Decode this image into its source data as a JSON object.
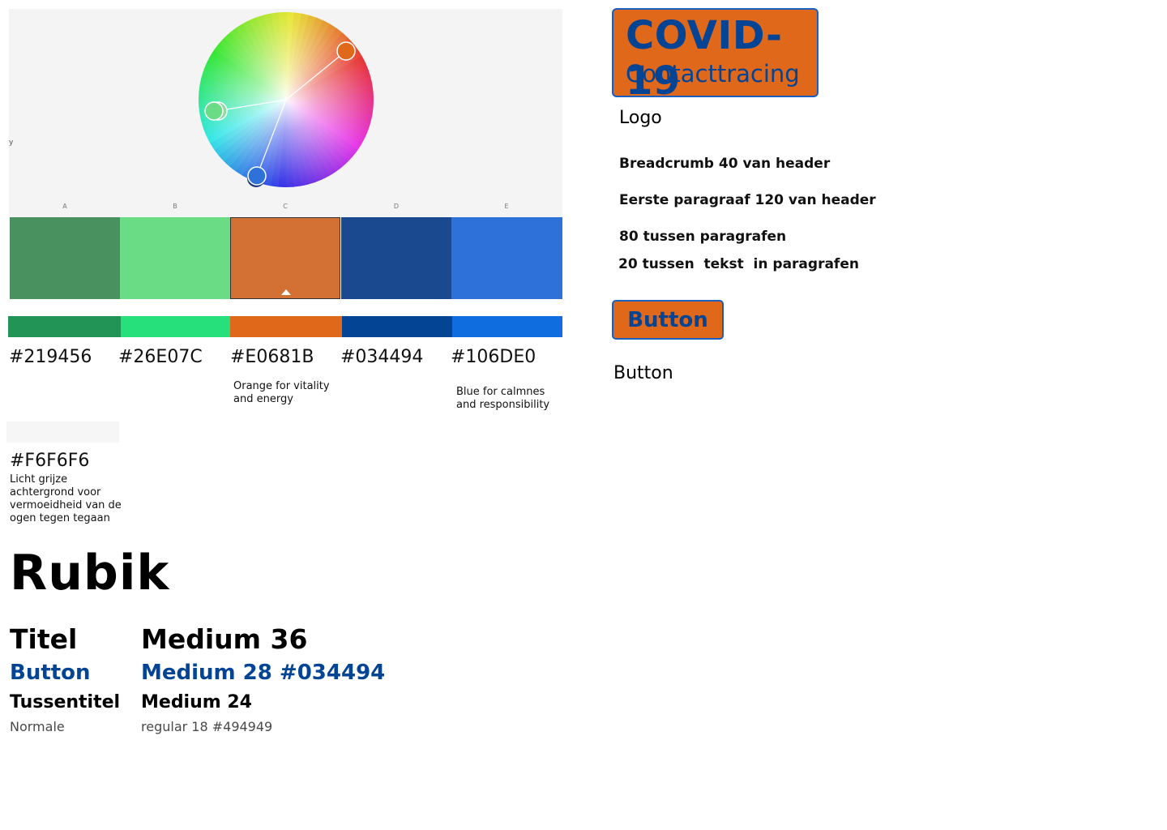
{
  "palette": {
    "side_label": "y",
    "letters": [
      "A",
      "B",
      "C",
      "D",
      "E"
    ],
    "big_swatches": [
      "#4A9160",
      "#6ADC86",
      "#D27133",
      "#1A4990",
      "#2D71D9"
    ],
    "colors": [
      {
        "hex": "#219456"
      },
      {
        "hex": "#26E07C"
      },
      {
        "hex": "#E0681B",
        "note": [
          "Orange for vitality",
          "and energy"
        ]
      },
      {
        "hex": "#034494"
      },
      {
        "hex": "#106DE0",
        "note": [
          "Blue for calmnes",
          "and responsibility"
        ]
      }
    ],
    "background": {
      "hex": "#F6F6F6",
      "note": [
        "Licht grijze",
        "achtergrond voor",
        "vermoeidheid van de",
        "ogen tegen tegaan"
      ]
    }
  },
  "typography": {
    "font_name": "Rubik",
    "rows": [
      {
        "name": "Titel",
        "spec": "Medium 36"
      },
      {
        "name": "Button",
        "spec": "Medium 28 #034494"
      },
      {
        "name": "Tussentitel",
        "spec": "Medium 24"
      },
      {
        "name": "Normale",
        "spec": "regular 18 #494949"
      }
    ]
  },
  "logo": {
    "title": "COVID-19",
    "subtitle": "Contacttracing",
    "caption": "Logo"
  },
  "spacing": {
    "breadcrumb": "Breadcrumb 40 van header",
    "first_paragraph": "Eerste paragraaf 120 van header",
    "between_paragraphs": "80 tussen paragrafen",
    "within_paragraphs": "20 tussen  tekst  in paragrafen"
  },
  "button": {
    "label": "Button",
    "caption": "Button"
  },
  "colors": {
    "brand_orange": "#E0681B",
    "brand_blue": "#034494",
    "text_gray": "#494949"
  }
}
